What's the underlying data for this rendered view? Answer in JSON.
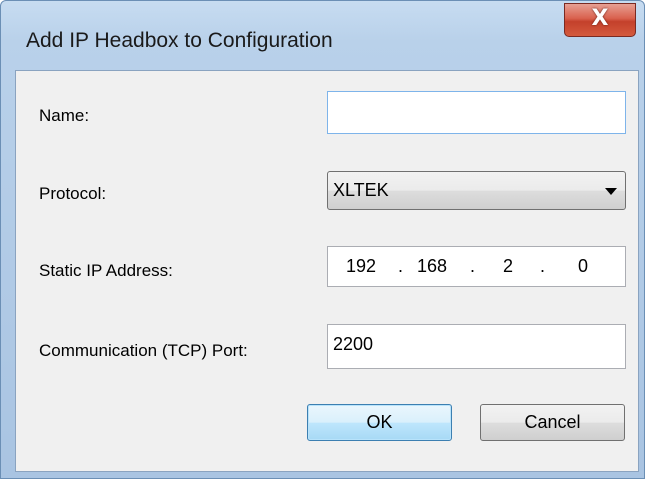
{
  "window": {
    "title": "Add IP Headbox to Configuration",
    "close_glyph": "X"
  },
  "form": {
    "name_label": "Name:",
    "name_value": "",
    "protocol_label": "Protocol:",
    "protocol_value": "XLTEK",
    "ip_label": "Static IP Address:",
    "ip_octets": [
      "192",
      "168",
      "2",
      "0"
    ],
    "ip_dot": ".",
    "port_label": "Communication (TCP) Port:",
    "port_value": "2200"
  },
  "buttons": {
    "ok_label": "OK",
    "cancel_label": "Cancel"
  },
  "icons": {
    "close": "close-icon",
    "dropdown": "chevron-down-icon"
  }
}
